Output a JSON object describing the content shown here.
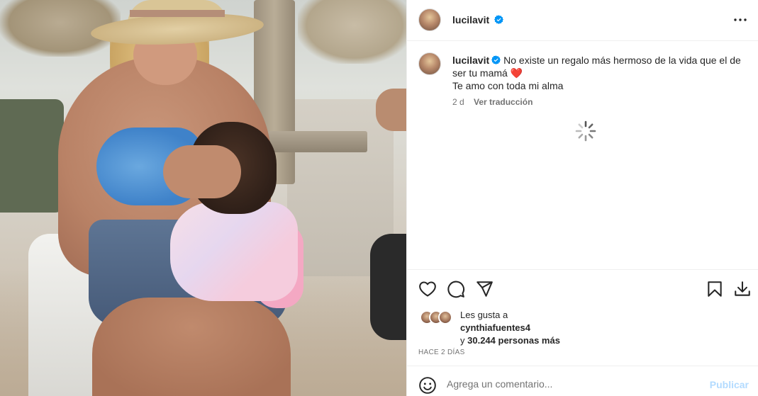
{
  "post": {
    "username": "lucilavit",
    "verified": true,
    "photo_description_icon": "photo"
  },
  "caption": {
    "username": "lucilavit",
    "text_line1": "No existe un regalo más hermoso de la vida que el de ser tu mamá",
    "heart": "❤️",
    "text_line2": "Te amo con toda mi alma"
  },
  "meta": {
    "time": "2 d",
    "translate_label": "Ver traducción"
  },
  "likes": {
    "prefix": "Les gusta a",
    "user": "cynthiafuentes4",
    "suffix_pre": "y",
    "count": "30.244 personas más"
  },
  "timeago": "HACE 2 DÍAS",
  "comment": {
    "placeholder": "Agrega un comentario...",
    "publish_label": "Publicar"
  },
  "icons": {
    "like": "heart-icon",
    "comment": "comment-icon",
    "share": "share-icon",
    "save": "bookmark-icon",
    "download": "download-icon",
    "more": "more-options-icon",
    "emoji": "emoji-icon",
    "verified": "verified-badge-icon",
    "loading": "loading-spinner-icon"
  },
  "colors": {
    "verified_blue": "#0095f6",
    "text_primary": "#262626",
    "text_secondary": "#737373",
    "publish_disabled": "#b3dbff",
    "heart_red": "#e0245e"
  }
}
